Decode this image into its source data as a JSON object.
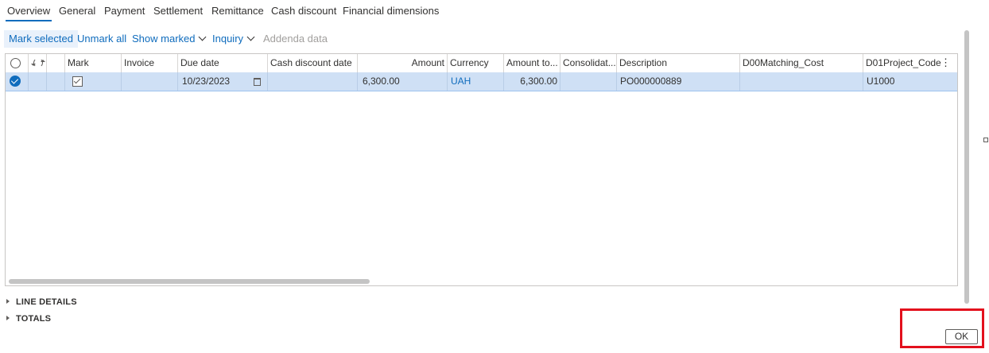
{
  "tabs": [
    "Overview",
    "General",
    "Payment",
    "Settlement",
    "Remittance",
    "Cash discount",
    "Financial dimensions"
  ],
  "toolbar": {
    "mark_selected": "Mark selected",
    "unmark_all": "Unmark all",
    "show_marked": "Show marked",
    "inquiry": "Inquiry",
    "addenda_data": "Addenda data"
  },
  "grid": {
    "columns": {
      "mark": "Mark",
      "invoice": "Invoice",
      "due_date": "Due date",
      "cash_discount_date": "Cash discount date",
      "amount": "Amount",
      "currency": "Currency",
      "amount_to": "Amount to...",
      "consolidat": "Consolidat...",
      "description": "Description",
      "d00": "D00Matching_Cost",
      "d01": "D01Project_Code"
    },
    "rows": [
      {
        "selected": true,
        "marked": true,
        "invoice": "",
        "due_date": "10/23/2023",
        "cash_discount_date": "",
        "amount": "6,300.00",
        "currency": "UAH",
        "amount_to": "6,300.00",
        "consolidat": "",
        "description": "PO000000889",
        "d00": "",
        "d01": "U1000"
      }
    ]
  },
  "sections": {
    "line_details": "LINE DETAILS",
    "totals": "TOTALS"
  },
  "ok_button": "OK",
  "colors": {
    "accent": "#0f6cbd",
    "selected_row": "#cfe0f5",
    "highlight": "#e3101d"
  },
  "icons": {
    "select_all": "radio-circle-icon",
    "refresh": "refresh-icon",
    "row_selected": "checkmark-circle-icon",
    "mark_checkbox": "checkbox-checked-icon",
    "calendar": "calendar-icon",
    "more": "more-vertical-icon",
    "expand": "caret-right-icon",
    "chevron": "chevron-down-icon"
  }
}
